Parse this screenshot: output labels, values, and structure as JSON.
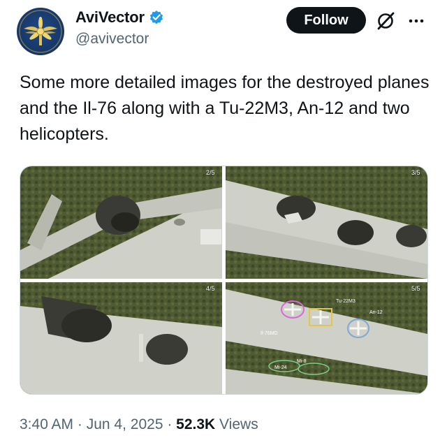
{
  "author": {
    "display_name": "AviVector",
    "handle": "@avivector",
    "verified": true,
    "avatar_icon": "winged-propeller-emblem-icon"
  },
  "actions": {
    "follow_label": "Follow",
    "grok_icon": "grok-slash-icon",
    "more_icon": "more-dots-icon"
  },
  "tweet": {
    "text": "Some more detailed images for the destroyed planes and the Il-76 along with a Tu-22M3, An-12 and two helicopters."
  },
  "media": {
    "tiles": [
      {
        "counter": "2/5"
      },
      {
        "counter": "3/5"
      },
      {
        "counter": "4/5"
      },
      {
        "counter": "5/5"
      }
    ],
    "annotations": [
      "Tu-22M3",
      "An-12",
      "Il-76MD",
      "Mi-8",
      "Mi-24"
    ]
  },
  "meta": {
    "time": "3:40 AM",
    "sep1": " · ",
    "date": "Jun 4, 2025",
    "sep2": " · ",
    "views_count": "52.3K",
    "views_label": " Views"
  },
  "colors": {
    "follow_bg": "#0f1419",
    "verified_blue": "#1d9bf0",
    "muted_text": "#536471",
    "ann_magenta": "#d56ad9",
    "ann_yellow": "#e2c64a",
    "ann_blue": "#7fa9d6",
    "ann_green": "#7ad08a"
  }
}
